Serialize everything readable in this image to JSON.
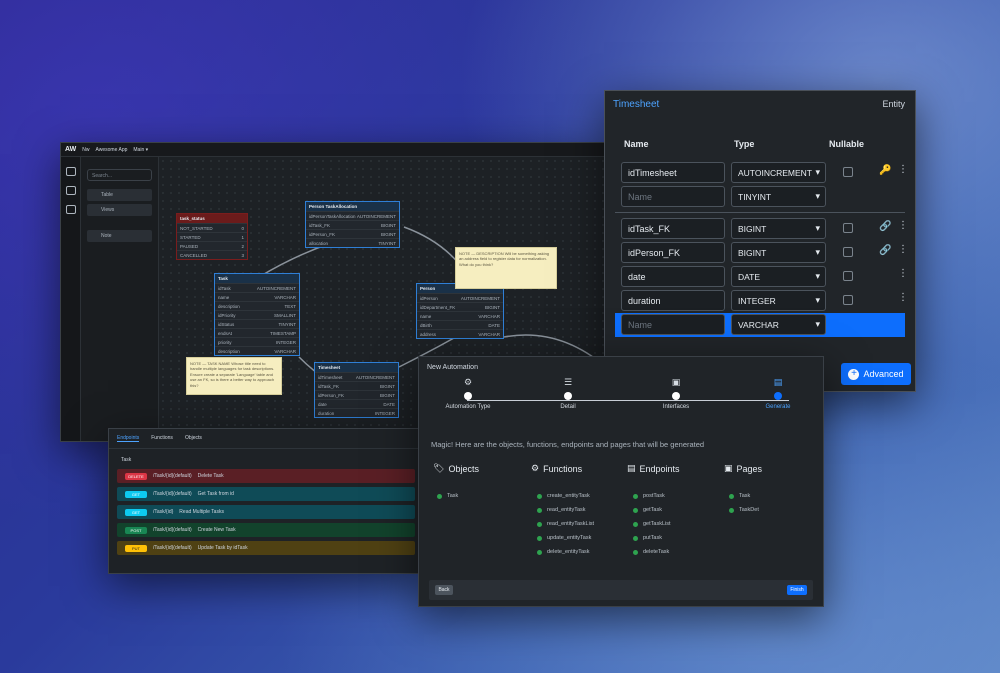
{
  "designer": {
    "logo": "AW",
    "crumb1": "Nw",
    "crumb2": "Awesome App",
    "crumb3": "Main ▾",
    "search_placeholder": "Search...",
    "panel_items": [
      "Table",
      "Views",
      "Note"
    ],
    "tables": [
      {
        "name": "Person TaskAllocation",
        "rows": [
          [
            "idPersonTaskAllocation",
            "AUTOINCREMENT"
          ],
          [
            "idTask_FK",
            "BIGINT"
          ],
          [
            "idPerson_FK",
            "BIGINT"
          ],
          [
            "allocation",
            "TINYINT"
          ]
        ]
      },
      {
        "name": "Task",
        "rows": [
          [
            "idTask",
            "AUTOINCREMENT"
          ],
          [
            "name",
            "VARCHAR"
          ],
          [
            "description",
            "TEXT"
          ],
          [
            "idPriority",
            "SMALLINT"
          ],
          [
            "idStatus",
            "TINYINT"
          ],
          [
            "endsAt",
            "TIMESTAMP"
          ],
          [
            "priority",
            "INTEGER"
          ],
          [
            "description",
            "VARCHAR"
          ]
        ]
      },
      {
        "name": "Person",
        "rows": [
          [
            "idPerson",
            "AUTOINCREMENT"
          ],
          [
            "idDepartment_FK",
            "BIGINT"
          ],
          [
            "name",
            "VARCHAR"
          ],
          [
            "dBirth",
            "DATE"
          ],
          [
            "address",
            "VARCHAR"
          ]
        ]
      },
      {
        "name": "Timesheet",
        "rows": [
          [
            "idTimesheet",
            "AUTOINCREMENT"
          ],
          [
            "idTask_FK",
            "BIGINT"
          ],
          [
            "idPerson_FK",
            "BIGINT"
          ],
          [
            "date",
            "DATE"
          ],
          [
            "duration",
            "INTEGER"
          ]
        ]
      },
      {
        "name": "task_status",
        "rows": [
          [
            "NOT_STARTED",
            "0"
          ],
          [
            "STARTED",
            "1"
          ],
          [
            "PAUSED",
            "2"
          ],
          [
            "CANCELLED",
            "3"
          ]
        ]
      }
    ],
    "notes": [
      "NOTE — DESCRIPTION Will be something asking an address field to register data for normalization. What do you think?",
      "NOTE — TASK NAME Whose title need to handle multiple languages for task descriptions. Ensure create a separate 'Language' table and use an FK, so is there a better way to approach this?"
    ]
  },
  "entity": {
    "title": "Timesheet",
    "kind": "Entity",
    "col_name": "Name",
    "col_type": "Type",
    "col_nullable": "Nullable",
    "fields": [
      {
        "name": "idTimesheet",
        "type": "AUTOINCREMENT",
        "icon": "🔑"
      },
      {
        "name": "Name",
        "type": "TINYINT",
        "placeholder": true
      },
      {
        "name": "idTask_FK",
        "type": "BIGINT",
        "icon": "🔗"
      },
      {
        "name": "idPerson_FK",
        "type": "BIGINT",
        "icon": "🔗"
      },
      {
        "name": "date",
        "type": "DATE",
        "icon": ""
      },
      {
        "name": "duration",
        "type": "INTEGER",
        "icon": ""
      },
      {
        "name": "Name",
        "type": "VARCHAR",
        "placeholder": true
      }
    ],
    "advanced": "Advanced"
  },
  "endpoints": {
    "tabs": [
      "Endpoints",
      "Functions",
      "Objects"
    ],
    "section": "Task",
    "rows": [
      {
        "method": "DELETE",
        "color": "#dc3545",
        "bg": "#5a1f25",
        "path": "/Task/{id}(default)",
        "desc": "Delete Task"
      },
      {
        "method": "GET",
        "color": "#0dcaf0",
        "bg": "#0f4b57",
        "path": "/Task/{id}(default)",
        "desc": "Get Task from id"
      },
      {
        "method": "GET",
        "color": "#0dcaf0",
        "bg": "#0f4b57",
        "path": "/Task/{id}",
        "desc": "Read Multiple Tasks"
      },
      {
        "method": "POST",
        "color": "#198754",
        "bg": "#12432c",
        "path": "/Task/{id}(default)",
        "desc": "Create New Task"
      },
      {
        "method": "PUT",
        "color": "#ffc107",
        "bg": "#4f4113",
        "path": "/Task/{id}(default)",
        "desc": "Update Task by idTask"
      }
    ]
  },
  "automation": {
    "title": "New Automation",
    "steps": [
      "Automation Type",
      "Detail",
      "Interfaces",
      "Generate"
    ],
    "magic": "Magic! Here are the objects, functions, endpoints and pages that will be generated",
    "objects": {
      "label": "Objects",
      "items": [
        "Task"
      ]
    },
    "functions": {
      "label": "Functions",
      "items": [
        "create_entityTask",
        "read_entityTask",
        "read_entityTaskList",
        "update_entityTask",
        "delete_entityTask"
      ]
    },
    "endpoints": {
      "label": "Endpoints",
      "items": [
        "postTask",
        "getTask",
        "getTaskList",
        "putTask",
        "deleteTask"
      ]
    },
    "pages": {
      "label": "Pages",
      "items": [
        "Task",
        "TaskDet"
      ]
    },
    "back": "Back",
    "finish": "Finish"
  }
}
